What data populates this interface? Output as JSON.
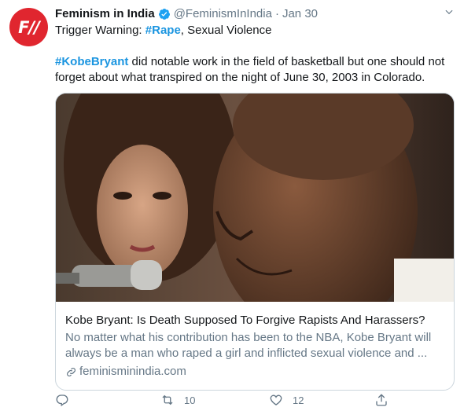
{
  "tweet": {
    "avatar_text": "F//",
    "author_name": "Feminism in India",
    "verified_icon": "verified-badge-icon",
    "handle": "@FeminismInIndia",
    "separator": "·",
    "date": "Jan 30",
    "line1_prefix": "Trigger Warning: ",
    "line1_hashtag": "#Rape",
    "line1_suffix": ", Sexual Violence",
    "para2_hashtag": "#KobeBryant",
    "para2_text": " did notable work in the field of basketball but one should not forget about what transpired on the night of June 30, 2003 in Colorado."
  },
  "card": {
    "title": "Kobe Bryant: Is Death Supposed To Forgive Rapists And Harassers?",
    "description": "No matter what his contribution has been to the NBA, Kobe Bryant will always be a man who raped a girl and inflicted sexual violence and ...",
    "domain": "feminisminindia.com",
    "link_icon": "link-icon"
  },
  "actions": {
    "reply_icon": "reply-icon",
    "retweet_icon": "retweet-icon",
    "retweet_count": "10",
    "like_icon": "heart-icon",
    "like_count": "12",
    "share_icon": "share-icon"
  },
  "colors": {
    "brand_red": "#e0262f",
    "link_blue": "#1b95e0",
    "muted_gray": "#657786",
    "border": "#ccd6dd"
  }
}
